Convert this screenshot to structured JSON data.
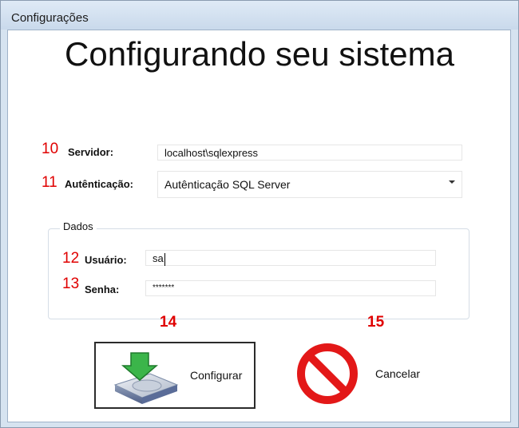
{
  "window": {
    "title": "Configurações"
  },
  "main": {
    "heading": "Configurando seu sistema"
  },
  "server": {
    "number": "10",
    "label": "Servidor:",
    "value": "localhost\\sqlexpress"
  },
  "auth": {
    "number": "11",
    "label": "Autênticação:",
    "selected": "Autênticação SQL Server"
  },
  "dados": {
    "legend": "Dados",
    "user": {
      "number": "12",
      "label": "Usuário:",
      "value": "sa"
    },
    "password": {
      "number": "13",
      "label": "Senha:",
      "value": "*******"
    }
  },
  "buttons": {
    "configure": {
      "number": "14",
      "label": "Configurar"
    },
    "cancel": {
      "number": "15",
      "label": "Cancelar"
    }
  },
  "icons": {
    "configure": "disk-download-icon",
    "cancel": "prohibited-icon"
  },
  "colors": {
    "accent_red": "#e00000",
    "arrow_green": "#3bb54a"
  }
}
